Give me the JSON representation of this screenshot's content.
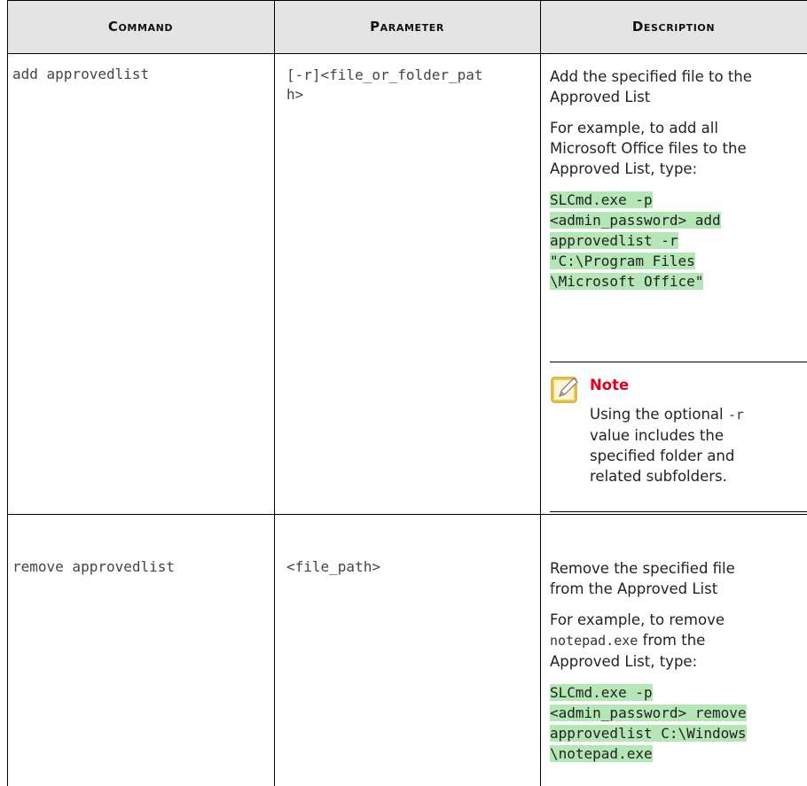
{
  "columns": [
    "Command",
    "Parameter",
    "Description"
  ],
  "rows": [
    {
      "command": "add approvedlist",
      "parameter_line1": "[-r]<file_or_folder_pat",
      "parameter_line2": "h>",
      "desc1_l1": "Add the specified file to the",
      "desc1_l2": "Approved List",
      "desc2_l1": "For example, to add all",
      "desc2_l2": "Microsoft Office files to the",
      "desc2_l3": "Approved List, type:",
      "code_l1": "SLCmd.exe -p",
      "code_l2": "<admin_password> add",
      "code_l3": "approvedlist -r",
      "code_l4": "\"C:\\Program Files",
      "code_l5": "\\Microsoft Office\"",
      "note_title": "Note",
      "note_l1_pre": "Using the optional ",
      "note_l1_code": "-r",
      "note_l2": "value includes the",
      "note_l3": "specified folder and",
      "note_l4": "related subfolders."
    },
    {
      "command": "remove approvedlist",
      "parameter": "<file_path>",
      "desc1_l1": "Remove the specified file",
      "desc1_l2": "from the Approved List",
      "desc2_l1": "For example, to remove",
      "desc2_l2_code": "notepad.exe",
      "desc2_l2_rest": " from the",
      "desc2_l3": "Approved List, type:",
      "code_l1": "SLCmd.exe -p",
      "code_l2": "<admin_password> remove",
      "code_l3": "approvedlist C:\\Windows",
      "code_l4": "\\notepad.exe"
    }
  ],
  "colors": {
    "header_bg": "#e4e4e4",
    "code_highlight": "#b5e6b5",
    "note_title": "#e0001b",
    "note_icon": "#f6c94a"
  }
}
